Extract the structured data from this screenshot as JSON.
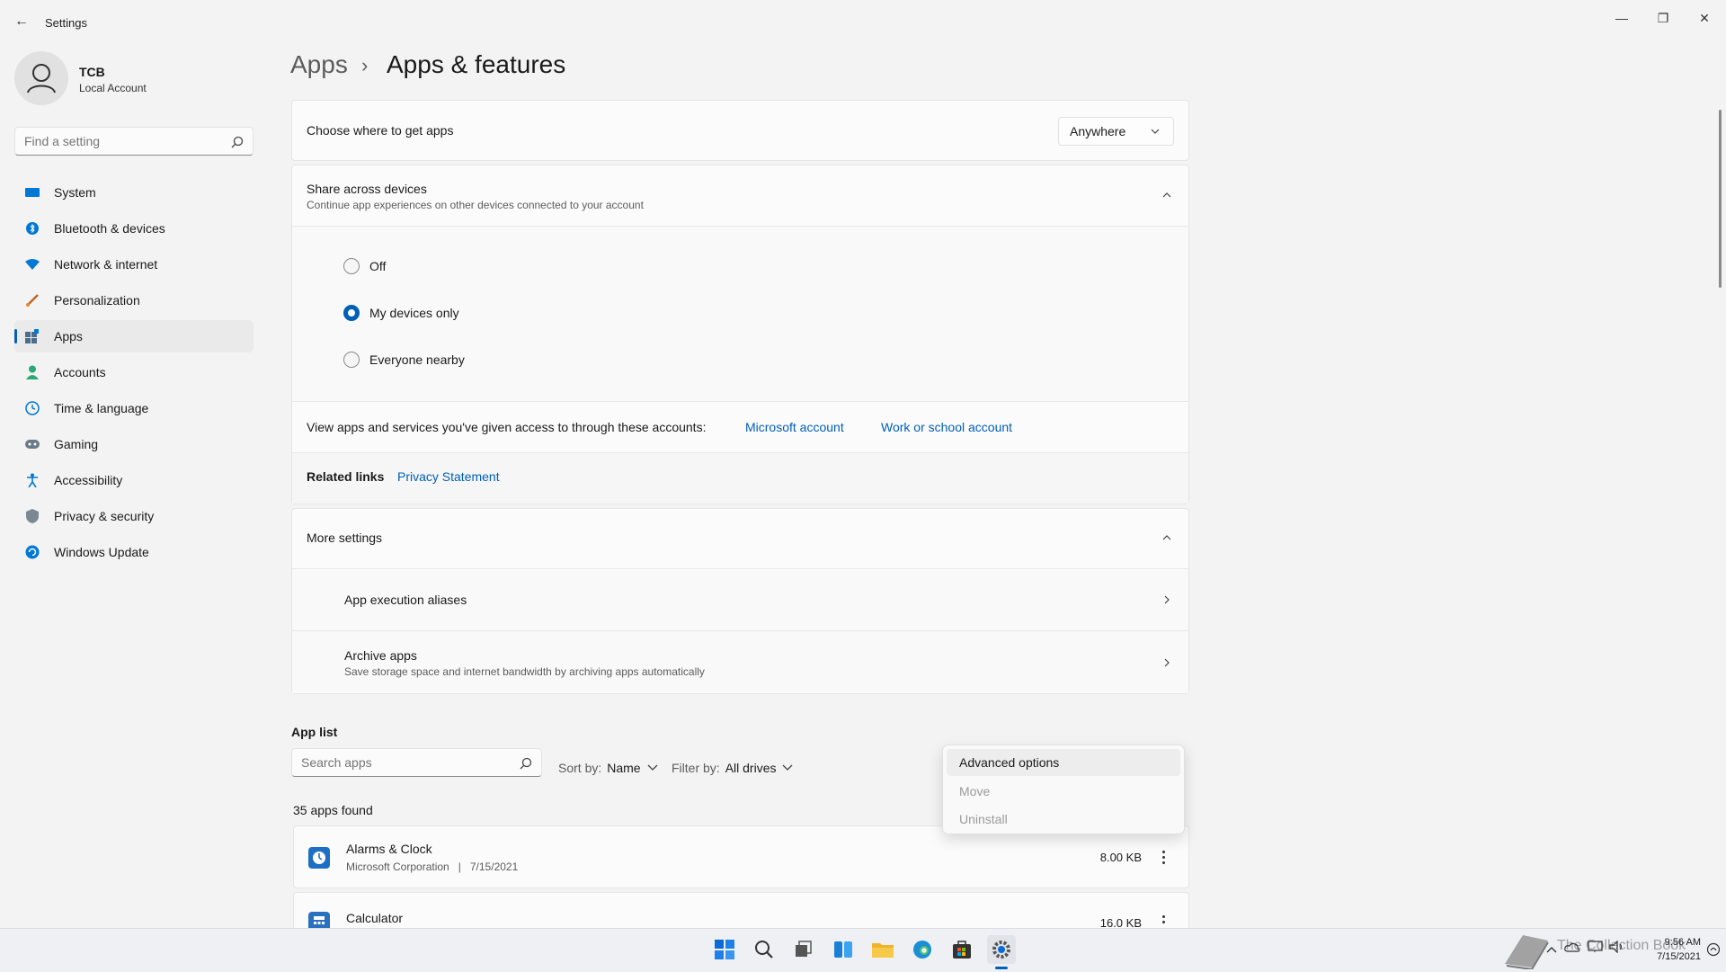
{
  "window": {
    "title": "Settings",
    "back_glyph": "←",
    "minimize_glyph": "—",
    "restore_glyph": "❐",
    "close_glyph": "✕"
  },
  "user": {
    "name": "TCB",
    "account_type": "Local Account"
  },
  "search": {
    "placeholder": "Find a setting"
  },
  "sidebar": {
    "items": [
      {
        "label": "System",
        "icon": "system-icon"
      },
      {
        "label": "Bluetooth & devices",
        "icon": "bluetooth-icon"
      },
      {
        "label": "Network & internet",
        "icon": "wifi-icon"
      },
      {
        "label": "Personalization",
        "icon": "brush-icon"
      },
      {
        "label": "Apps",
        "icon": "apps-icon",
        "selected": true
      },
      {
        "label": "Accounts",
        "icon": "person-icon"
      },
      {
        "label": "Time & language",
        "icon": "globe-clock-icon"
      },
      {
        "label": "Gaming",
        "icon": "gamepad-icon"
      },
      {
        "label": "Accessibility",
        "icon": "accessibility-icon"
      },
      {
        "label": "Privacy & security",
        "icon": "shield-icon"
      },
      {
        "label": "Windows Update",
        "icon": "update-icon"
      }
    ]
  },
  "breadcrumb": {
    "parent": "Apps",
    "separator": "›",
    "current": "Apps & features"
  },
  "get_apps": {
    "label": "Choose where to get apps",
    "value": "Anywhere"
  },
  "share": {
    "title": "Share across devices",
    "description": "Continue app experiences on other devices connected to your account",
    "options": [
      "Off",
      "My devices only",
      "Everyone nearby"
    ],
    "selected": "My devices only"
  },
  "accounts_row": {
    "label": "View apps and services you've given access to through these accounts:",
    "link1": "Microsoft account",
    "link2": "Work or school account"
  },
  "related": {
    "label": "Related links",
    "link": "Privacy Statement"
  },
  "more_settings": {
    "title": "More settings",
    "items": [
      {
        "label": "App execution aliases",
        "description": ""
      },
      {
        "label": "Archive apps",
        "description": "Save storage space and internet bandwidth by archiving apps automatically"
      }
    ]
  },
  "app_list": {
    "title": "App list",
    "search_placeholder": "Search apps",
    "sort_label": "Sort by:",
    "sort_value": "Name",
    "filter_label": "Filter by:",
    "filter_value": "All drives",
    "count": "35 apps found",
    "apps": [
      {
        "name": "Alarms & Clock",
        "publisher": "Microsoft Corporation",
        "separator": "|",
        "date": "7/15/2021",
        "size": "8.00 KB",
        "icon_color": "#1e6fc4"
      },
      {
        "name": "Calculator",
        "publisher": "",
        "separator": "",
        "date": "",
        "size": "16.0 KB",
        "icon_color": "#2a70c0"
      }
    ]
  },
  "context_menu": {
    "items": [
      {
        "label": "Advanced options",
        "state": "hover"
      },
      {
        "label": "Move",
        "state": "disabled"
      },
      {
        "label": "Uninstall",
        "state": "disabled"
      }
    ]
  },
  "taskbar": {
    "icons": [
      "start-icon",
      "search-icon",
      "task-view-icon",
      "widgets-icon",
      "file-explorer-icon",
      "edge-icon",
      "store-icon",
      "settings-icon"
    ],
    "active": "settings-icon",
    "watermark": "The Collection Book",
    "time": "9:56 AM",
    "date": "7/15/2021"
  },
  "colors": {
    "accent": "#005fb8",
    "background": "#f3f3f3",
    "card": "#fbfbfb"
  }
}
